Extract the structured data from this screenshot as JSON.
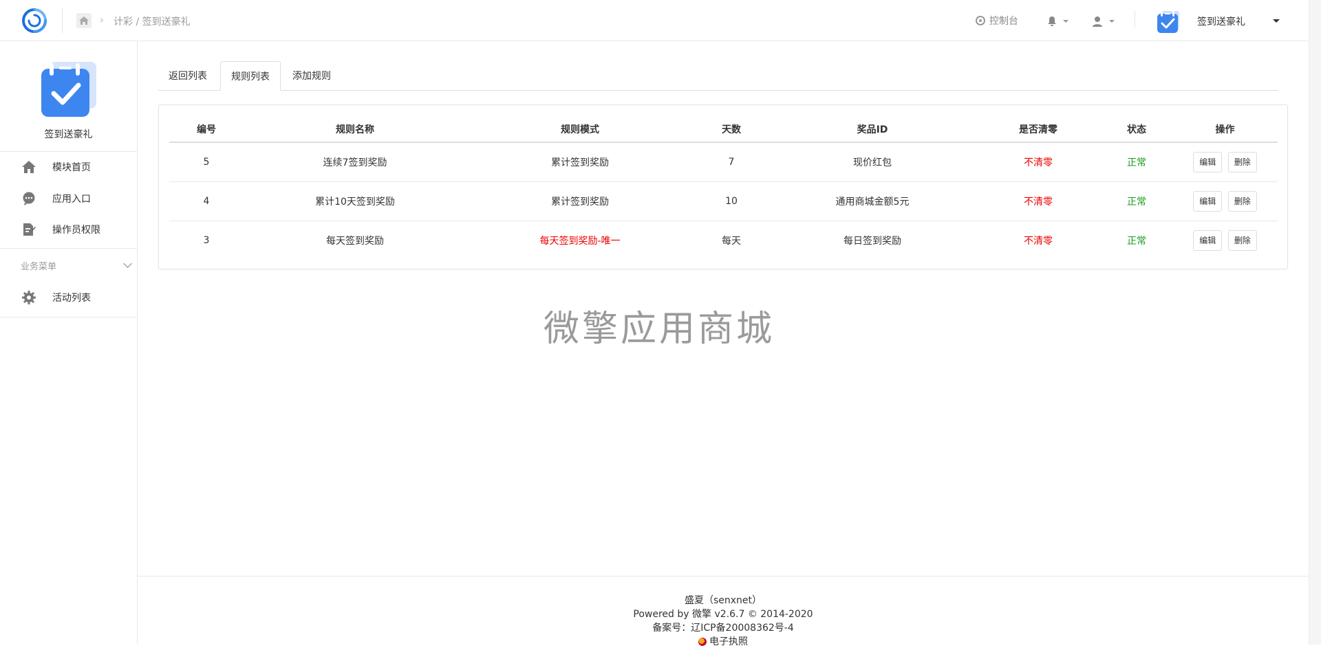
{
  "breadcrumb": {
    "text": "计彩 / 签到送豪礼"
  },
  "header": {
    "console_label": "控制台",
    "app_name": "签到送豪礼"
  },
  "sidebar": {
    "app_name": "签到送豪礼",
    "items": [
      {
        "label": "模块首页",
        "icon": "home-icon"
      },
      {
        "label": "应用入口",
        "icon": "chat-bubble-icon"
      },
      {
        "label": "操作员权限",
        "icon": "document-edit-icon"
      }
    ],
    "group_label": "业务菜单",
    "group_items": [
      {
        "label": "活动列表",
        "icon": "gear-icon"
      }
    ]
  },
  "tabs": [
    {
      "label": "返回列表",
      "active": false
    },
    {
      "label": "规则列表",
      "active": true
    },
    {
      "label": "添加规则",
      "active": false
    }
  ],
  "table": {
    "headers": [
      "编号",
      "规则名称",
      "规则模式",
      "天数",
      "奖品ID",
      "是否清零",
      "状态",
      "操作"
    ],
    "rows": [
      {
        "id": "5",
        "name": "连续7签到奖励",
        "mode": "累计签到奖励",
        "days": "7",
        "prize": "现价红包",
        "reset": "不清零",
        "status": "正常"
      },
      {
        "id": "4",
        "name": "累计10天签到奖励",
        "mode": "累计签到奖励",
        "days": "10",
        "prize": "通用商城金额5元",
        "reset": "不清零",
        "status": "正常"
      },
      {
        "id": "3",
        "name": "每天签到奖励",
        "mode": "每天签到奖励-唯一",
        "days": "每天",
        "prize": "每日签到奖励",
        "reset": "不清零",
        "status": "正常"
      }
    ],
    "edit_label": "编辑",
    "delete_label": "删除"
  },
  "watermark": "微擎应用商城",
  "footer": {
    "line1": "盛夏（senxnet）",
    "line2": "Powered by 微擎 v2.6.7 © 2014-2020",
    "line3": "备案号：辽ICP备20008362号-4",
    "line4": "电子执照"
  },
  "colors": {
    "accent": "#3a7bd5",
    "danger": "#ee0000",
    "success": "#1a9c1a"
  }
}
